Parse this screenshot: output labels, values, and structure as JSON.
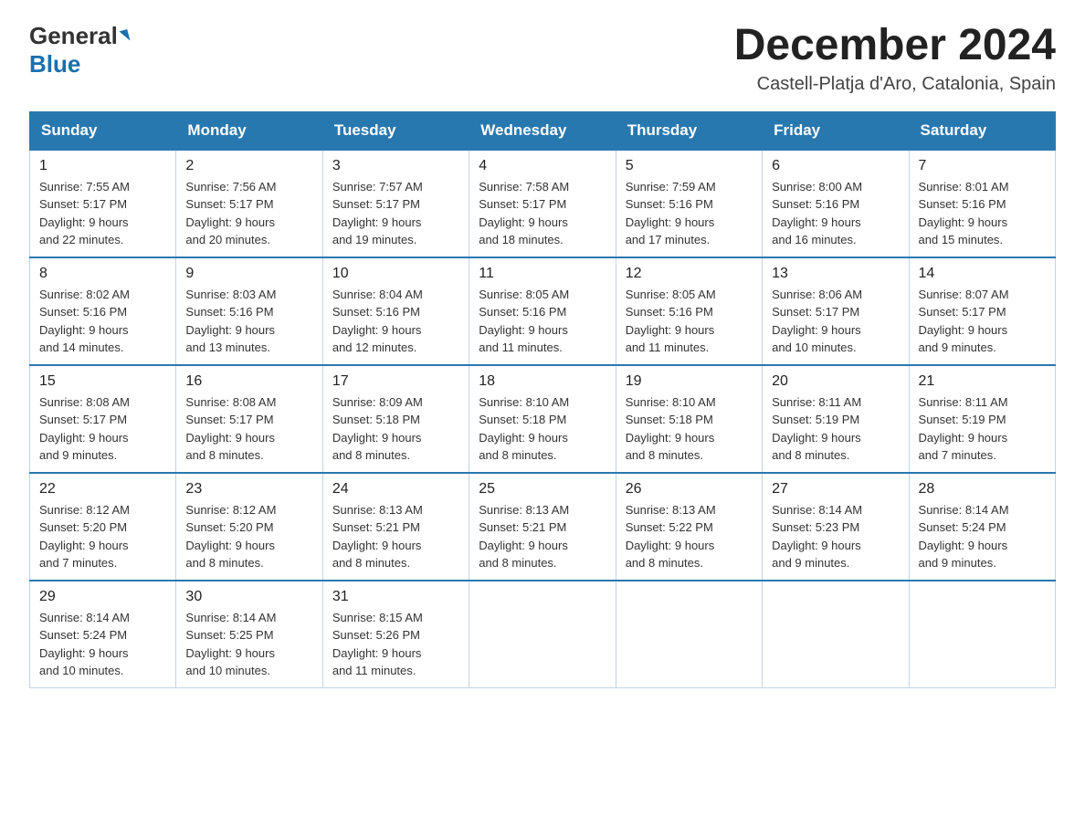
{
  "header": {
    "logo_general": "General",
    "logo_blue": "Blue",
    "month_title": "December 2024",
    "location": "Castell-Platja d'Aro, Catalonia, Spain"
  },
  "days_of_week": [
    "Sunday",
    "Monday",
    "Tuesday",
    "Wednesday",
    "Thursday",
    "Friday",
    "Saturday"
  ],
  "weeks": [
    [
      {
        "day": "1",
        "sunrise": "7:55 AM",
        "sunset": "5:17 PM",
        "daylight": "9 hours and 22 minutes."
      },
      {
        "day": "2",
        "sunrise": "7:56 AM",
        "sunset": "5:17 PM",
        "daylight": "9 hours and 20 minutes."
      },
      {
        "day": "3",
        "sunrise": "7:57 AM",
        "sunset": "5:17 PM",
        "daylight": "9 hours and 19 minutes."
      },
      {
        "day": "4",
        "sunrise": "7:58 AM",
        "sunset": "5:17 PM",
        "daylight": "9 hours and 18 minutes."
      },
      {
        "day": "5",
        "sunrise": "7:59 AM",
        "sunset": "5:16 PM",
        "daylight": "9 hours and 17 minutes."
      },
      {
        "day": "6",
        "sunrise": "8:00 AM",
        "sunset": "5:16 PM",
        "daylight": "9 hours and 16 minutes."
      },
      {
        "day": "7",
        "sunrise": "8:01 AM",
        "sunset": "5:16 PM",
        "daylight": "9 hours and 15 minutes."
      }
    ],
    [
      {
        "day": "8",
        "sunrise": "8:02 AM",
        "sunset": "5:16 PM",
        "daylight": "9 hours and 14 minutes."
      },
      {
        "day": "9",
        "sunrise": "8:03 AM",
        "sunset": "5:16 PM",
        "daylight": "9 hours and 13 minutes."
      },
      {
        "day": "10",
        "sunrise": "8:04 AM",
        "sunset": "5:16 PM",
        "daylight": "9 hours and 12 minutes."
      },
      {
        "day": "11",
        "sunrise": "8:05 AM",
        "sunset": "5:16 PM",
        "daylight": "9 hours and 11 minutes."
      },
      {
        "day": "12",
        "sunrise": "8:05 AM",
        "sunset": "5:16 PM",
        "daylight": "9 hours and 11 minutes."
      },
      {
        "day": "13",
        "sunrise": "8:06 AM",
        "sunset": "5:17 PM",
        "daylight": "9 hours and 10 minutes."
      },
      {
        "day": "14",
        "sunrise": "8:07 AM",
        "sunset": "5:17 PM",
        "daylight": "9 hours and 9 minutes."
      }
    ],
    [
      {
        "day": "15",
        "sunrise": "8:08 AM",
        "sunset": "5:17 PM",
        "daylight": "9 hours and 9 minutes."
      },
      {
        "day": "16",
        "sunrise": "8:08 AM",
        "sunset": "5:17 PM",
        "daylight": "9 hours and 8 minutes."
      },
      {
        "day": "17",
        "sunrise": "8:09 AM",
        "sunset": "5:18 PM",
        "daylight": "9 hours and 8 minutes."
      },
      {
        "day": "18",
        "sunrise": "8:10 AM",
        "sunset": "5:18 PM",
        "daylight": "9 hours and 8 minutes."
      },
      {
        "day": "19",
        "sunrise": "8:10 AM",
        "sunset": "5:18 PM",
        "daylight": "9 hours and 8 minutes."
      },
      {
        "day": "20",
        "sunrise": "8:11 AM",
        "sunset": "5:19 PM",
        "daylight": "9 hours and 8 minutes."
      },
      {
        "day": "21",
        "sunrise": "8:11 AM",
        "sunset": "5:19 PM",
        "daylight": "9 hours and 7 minutes."
      }
    ],
    [
      {
        "day": "22",
        "sunrise": "8:12 AM",
        "sunset": "5:20 PM",
        "daylight": "9 hours and 7 minutes."
      },
      {
        "day": "23",
        "sunrise": "8:12 AM",
        "sunset": "5:20 PM",
        "daylight": "9 hours and 8 minutes."
      },
      {
        "day": "24",
        "sunrise": "8:13 AM",
        "sunset": "5:21 PM",
        "daylight": "9 hours and 8 minutes."
      },
      {
        "day": "25",
        "sunrise": "8:13 AM",
        "sunset": "5:21 PM",
        "daylight": "9 hours and 8 minutes."
      },
      {
        "day": "26",
        "sunrise": "8:13 AM",
        "sunset": "5:22 PM",
        "daylight": "9 hours and 8 minutes."
      },
      {
        "day": "27",
        "sunrise": "8:14 AM",
        "sunset": "5:23 PM",
        "daylight": "9 hours and 9 minutes."
      },
      {
        "day": "28",
        "sunrise": "8:14 AM",
        "sunset": "5:24 PM",
        "daylight": "9 hours and 9 minutes."
      }
    ],
    [
      {
        "day": "29",
        "sunrise": "8:14 AM",
        "sunset": "5:24 PM",
        "daylight": "9 hours and 10 minutes."
      },
      {
        "day": "30",
        "sunrise": "8:14 AM",
        "sunset": "5:25 PM",
        "daylight": "9 hours and 10 minutes."
      },
      {
        "day": "31",
        "sunrise": "8:15 AM",
        "sunset": "5:26 PM",
        "daylight": "9 hours and 11 minutes."
      },
      null,
      null,
      null,
      null
    ]
  ],
  "labels": {
    "sunrise": "Sunrise:",
    "sunset": "Sunset:",
    "daylight": "Daylight:"
  }
}
